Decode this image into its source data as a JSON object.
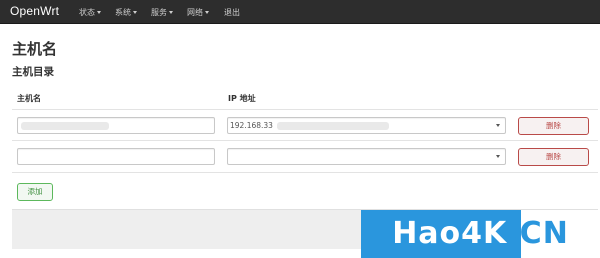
{
  "navbar": {
    "brand": "OpenWrt",
    "menu": [
      {
        "label": "状态",
        "dropdown": true
      },
      {
        "label": "系统",
        "dropdown": true
      },
      {
        "label": "服务",
        "dropdown": true
      },
      {
        "label": "网络",
        "dropdown": true
      },
      {
        "label": "退出",
        "dropdown": false
      }
    ]
  },
  "page": {
    "title": "主机名",
    "section_title": "主机目录"
  },
  "table": {
    "headers": [
      "主机名",
      "IP 地址"
    ],
    "rows": [
      {
        "hostname": "",
        "ip": "192.168.33",
        "remove_label": "删除"
      },
      {
        "hostname": "",
        "ip": "",
        "remove_label": "删除"
      }
    ]
  },
  "actions": {
    "add_label": "添加"
  },
  "watermark": {
    "part1": "Hao4K",
    "part2": ".CN"
  },
  "colors": {
    "navbar_bg": "#2d2d2d",
    "remove_red": "#b94a48",
    "add_green": "#5cb85c",
    "watermark_blue": "#2a96dd"
  }
}
